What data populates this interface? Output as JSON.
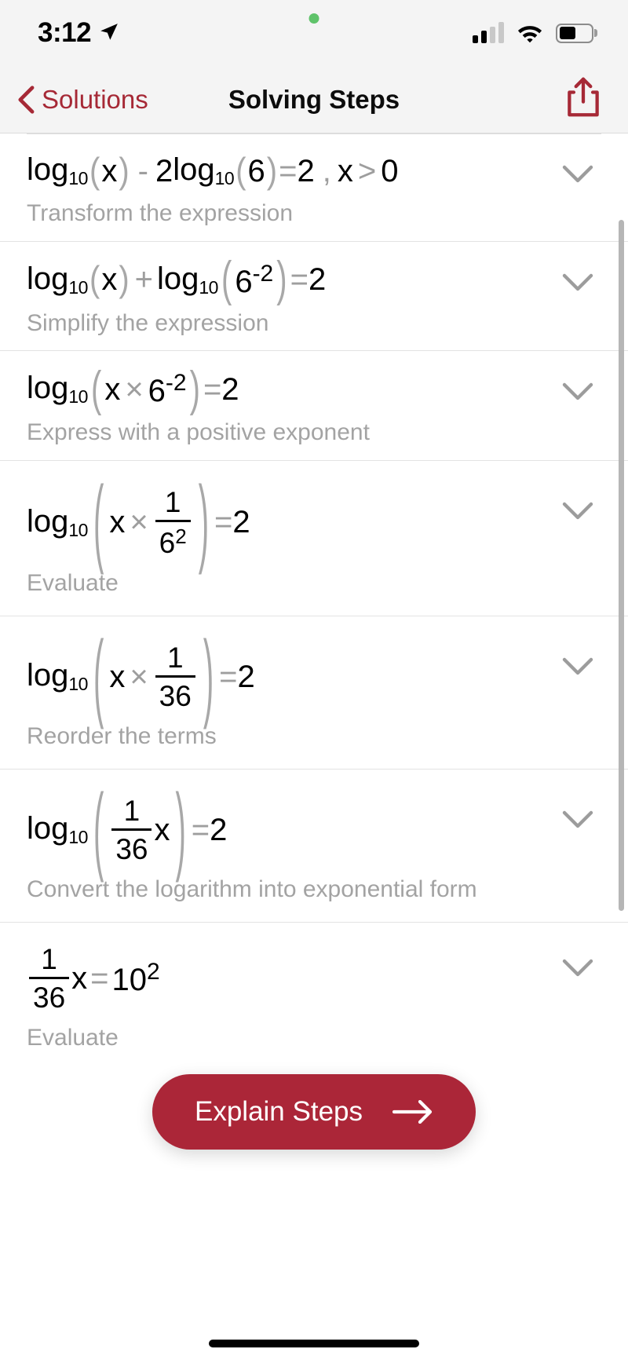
{
  "status_bar": {
    "time": "3:12",
    "location_icon": "location-arrow-icon",
    "privacy_indicator": "green-privacy-dot",
    "cellular_icon": "cellular-signal-icon",
    "wifi_icon": "wifi-icon",
    "battery_icon": "battery-icon",
    "battery_level_percent": 52
  },
  "nav_bar": {
    "back_label": "Solutions",
    "back_icon": "chevron-left-icon",
    "title": "Solving Steps",
    "share_icon": "share-icon"
  },
  "theme": {
    "accent": "#a62936",
    "button_fill": "#ab2638",
    "operator_gray": "#9e9e9e",
    "caption_gray": "#a3a3a3",
    "bar_background": "#f4f4f4"
  },
  "explain_button": {
    "label": "Explain Steps",
    "arrow_icon": "arrow-right-icon"
  },
  "steps": [
    {
      "id": "step-1",
      "equation_text": "log10(x) - 2log10(6) = 2 , x > 0",
      "caption": "Transform the expression",
      "expand_icon": "chevron-down-icon"
    },
    {
      "id": "step-2",
      "equation_text": "log10(x) + log10(6^-2) = 2",
      "caption": "Simplify the expression",
      "expand_icon": "chevron-down-icon"
    },
    {
      "id": "step-3",
      "equation_text": "log10(x × 6^-2) = 2",
      "caption": "Express with a positive exponent",
      "expand_icon": "chevron-down-icon"
    },
    {
      "id": "step-4",
      "equation_text": "log10(x × 1/6^2) = 2",
      "caption": "Evaluate",
      "expand_icon": "chevron-down-icon"
    },
    {
      "id": "step-5",
      "equation_text": "log10(x × 1/36) = 2",
      "caption": "Reorder the terms",
      "expand_icon": "chevron-down-icon"
    },
    {
      "id": "step-6",
      "equation_text": "log10(1/36 x) = 2",
      "caption": "Convert the logarithm into exponential form",
      "expand_icon": "chevron-down-icon"
    },
    {
      "id": "step-7",
      "equation_text": "1/36 x = 10^2",
      "caption": "Evaluate",
      "expand_icon": "chevron-down-icon"
    }
  ],
  "math_tokens": {
    "log": "log",
    "base10": "10",
    "x": "x",
    "minus": "-",
    "plus": "+",
    "times": "×",
    "equals": "=",
    "comma": ",",
    "gt": ">",
    "zero": "0",
    "one": "1",
    "two": "2",
    "six": "6",
    "thirtysix": "36",
    "neg_two": "-2",
    "ten": "10",
    "lparen": "(",
    "rparen": ")"
  }
}
